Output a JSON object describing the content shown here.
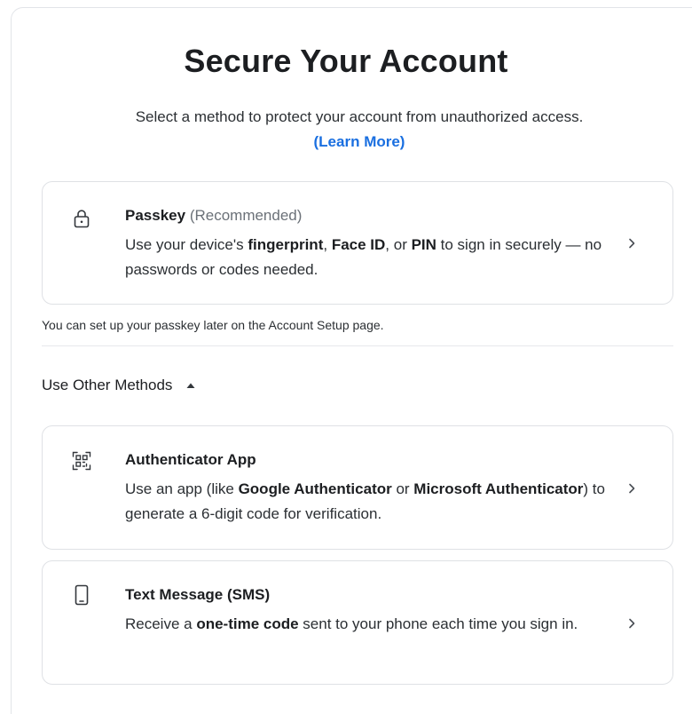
{
  "header": {
    "title": "Secure Your Account",
    "subtitle": "Select a method to protect your account from unauthorized access.",
    "learn_more": "(Learn More)"
  },
  "passkey": {
    "icon": "lock-icon",
    "title": "Passkey",
    "tag": "(Recommended)",
    "desc": {
      "p1": "Use your device's ",
      "b1": "fingerprint",
      "p2": ", ",
      "b2": "Face ID",
      "p3": ", or ",
      "b3": "PIN",
      "p4": " to sign in securely — no passwords or codes needed."
    }
  },
  "note": "You can set up your passkey later on the Account Setup page.",
  "other_methods": {
    "label": "Use Other Methods",
    "expanded": true
  },
  "authenticator": {
    "icon": "qr-scan-icon",
    "title": "Authenticator App",
    "desc": {
      "p1": "Use an app (like ",
      "b1": "Google Authenticator",
      "p2": " or ",
      "b2": "Microsoft Authenticator",
      "p3": ") to generate a 6-digit code for verification."
    }
  },
  "sms": {
    "icon": "smartphone-icon",
    "title": "Text Message (SMS)",
    "desc": {
      "p1": "Receive a ",
      "b1": "one-time code",
      "p2": " sent to your phone each time you sign in."
    }
  },
  "colors": {
    "link": "#1a6fe0",
    "border": "#dfe1e5",
    "text": "#1c1e21",
    "muted": "#6b7178"
  }
}
